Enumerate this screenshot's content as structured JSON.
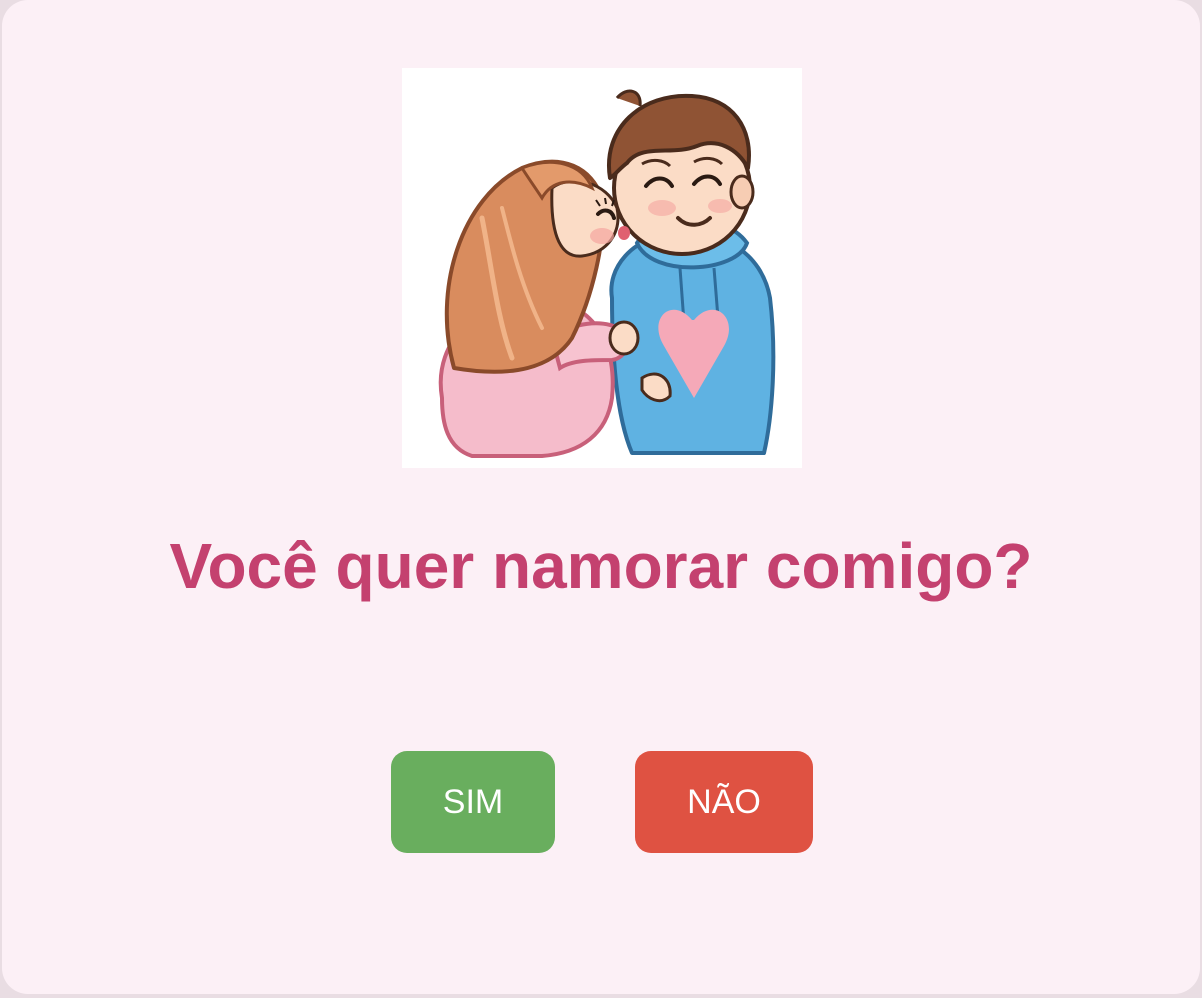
{
  "image": {
    "icon": "couple-kiss-illustration"
  },
  "question": "Você quer namorar comigo?",
  "buttons": {
    "yes_label": "SIM",
    "no_label": "NÃO"
  },
  "colors": {
    "background": "#fcf0f6",
    "question_text": "#c4416f",
    "yes_button": "#69ae5e",
    "no_button": "#df5242"
  }
}
